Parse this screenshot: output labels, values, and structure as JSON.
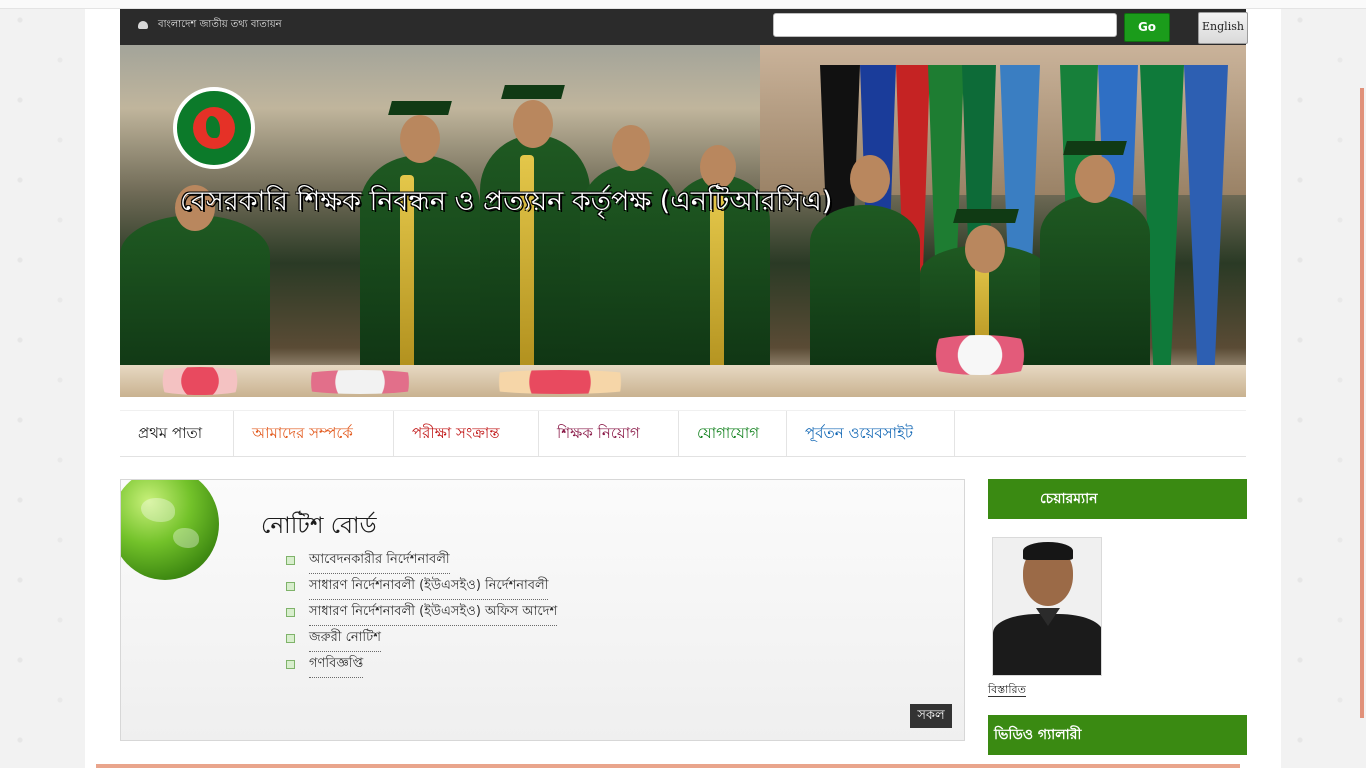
{
  "portal": {
    "name": "বাংলাদেশ জাতীয় তথ্য বাতায়ন",
    "search_placeholder": "",
    "go_label": "Go",
    "lang_label": "English"
  },
  "banner": {
    "title": "বেসরকারি শিক্ষক নিবন্ধন ও প্রত্যয়ন কর্তৃপক্ষ (এনটিআরসিএ)"
  },
  "nav": {
    "items": [
      {
        "label": "প্রথম পাতা",
        "color": "#1c1c1c"
      },
      {
        "label": "আমাদের সম্পর্কে",
        "color": "#e2581b"
      },
      {
        "label": "পরীক্ষা সংক্রান্ত",
        "color": "#c01414"
      },
      {
        "label": "শিক্ষক নিয়োগ",
        "color": "#8a1a48"
      },
      {
        "label": "যোগাযোগ",
        "color": "#10801c"
      },
      {
        "label": "পূর্বতন ওয়েবসাইট",
        "color": "#1066b4"
      }
    ]
  },
  "notice": {
    "title": "নোটিশ বোর্ড",
    "items": [
      "আবেদনকারীর নির্দেশনাবলী",
      "সাধারণ নির্দেশনাবলী (ইউএসইও) নির্দেশনাবলী",
      "সাধারণ নির্দেশনাবলী (ইউএসইও) অফিস আদেশ",
      "জরুরী নোটিশ",
      "গণবিজ্ঞপ্তি"
    ],
    "all_label": "সকল"
  },
  "sidebar": {
    "chairman_title": "চেয়ারম্যান",
    "details_label": "বিস্তারিত",
    "video_title": "ভিডিও গ্যালারী"
  },
  "colors": {
    "accent_green": "#3a8a12",
    "go_green": "#1b9c1b",
    "portal_bar": "#2b2b2b"
  }
}
